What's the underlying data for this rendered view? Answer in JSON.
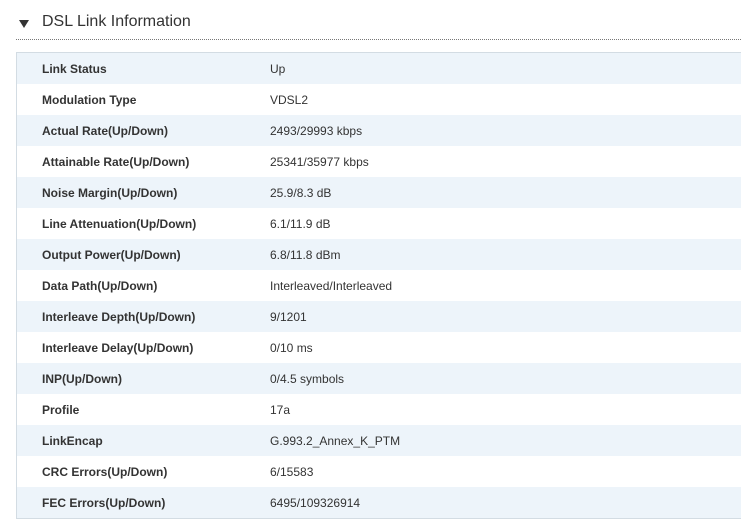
{
  "section": {
    "title": "DSL Link Information",
    "collapsed": false
  },
  "rows": [
    {
      "label": "Link Status",
      "value": "Up"
    },
    {
      "label": "Modulation Type",
      "value": "VDSL2"
    },
    {
      "label": "Actual Rate(Up/Down)",
      "value": "2493/29993 kbps"
    },
    {
      "label": "Attainable Rate(Up/Down)",
      "value": "25341/35977 kbps"
    },
    {
      "label": "Noise Margin(Up/Down)",
      "value": "25.9/8.3 dB"
    },
    {
      "label": "Line Attenuation(Up/Down)",
      "value": "6.1/11.9 dB"
    },
    {
      "label": "Output Power(Up/Down)",
      "value": "6.8/11.8 dBm"
    },
    {
      "label": "Data Path(Up/Down)",
      "value": "Interleaved/Interleaved"
    },
    {
      "label": "Interleave Depth(Up/Down)",
      "value": "9/1201"
    },
    {
      "label": "Interleave Delay(Up/Down)",
      "value": "0/10 ms"
    },
    {
      "label": "INP(Up/Down)",
      "value": "0/4.5 symbols"
    },
    {
      "label": "Profile",
      "value": "17a"
    },
    {
      "label": "LinkEncap",
      "value": "G.993.2_Annex_K_PTM"
    },
    {
      "label": "CRC Errors(Up/Down)",
      "value": "6/15583"
    },
    {
      "label": "FEC Errors(Up/Down)",
      "value": "6495/109326914"
    }
  ],
  "colors": {
    "row_alt": "#edf4fa",
    "text": "#333333",
    "border": "#d3dce3"
  }
}
